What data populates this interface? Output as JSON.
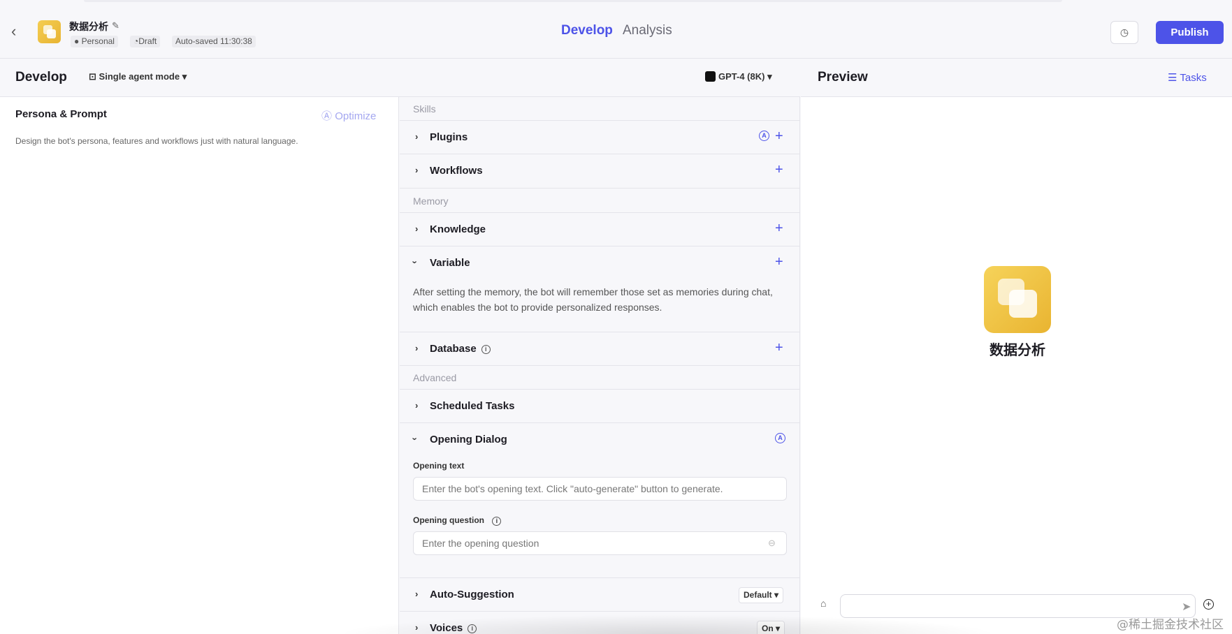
{
  "header": {
    "app_name": "数据分析",
    "meta_personal": "Personal",
    "meta_draft": "Draft",
    "meta_autosaved": "Auto-saved 11:30:38",
    "tabs": [
      {
        "label": "Develop"
      },
      {
        "label": "Analysis"
      }
    ],
    "publish_label": "Publish"
  },
  "develop": {
    "title": "Develop",
    "mode": "Single agent mode",
    "model": "GPT-4 (8K)"
  },
  "persona": {
    "title": "Persona & Prompt",
    "optimize": "Optimize",
    "description": "Design the bot's persona, features and workflows just with natural language."
  },
  "skills": {
    "section_label": "Skills",
    "plugins": "Plugins",
    "workflows": "Workflows"
  },
  "memory": {
    "section_label": "Memory",
    "knowledge": "Knowledge",
    "variable": "Variable",
    "variable_desc": "After setting the memory, the bot will remember those set as memories during chat, which enables the bot to provide personalized responses.",
    "database": "Database"
  },
  "advanced": {
    "section_label": "Advanced",
    "scheduled_tasks": "Scheduled Tasks",
    "opening_dialog": "Opening Dialog",
    "opening_text_label": "Opening text",
    "opening_text_placeholder": "Enter the bot's opening text. Click \"auto-generate\" button to generate.",
    "opening_question_label": "Opening question",
    "opening_question_placeholder": "Enter the opening question",
    "auto_suggestion": "Auto-Suggestion",
    "auto_suggestion_value": "Default",
    "voices": "Voices",
    "voices_value": "On"
  },
  "preview": {
    "title": "Preview",
    "tasks": "Tasks",
    "bot_name": "数据分析"
  },
  "watermark": "@稀土掘金技术社区",
  "colors": {
    "accent": "#4d53e8",
    "app_icon": "#f0c244",
    "background": "#f7f7fa"
  }
}
